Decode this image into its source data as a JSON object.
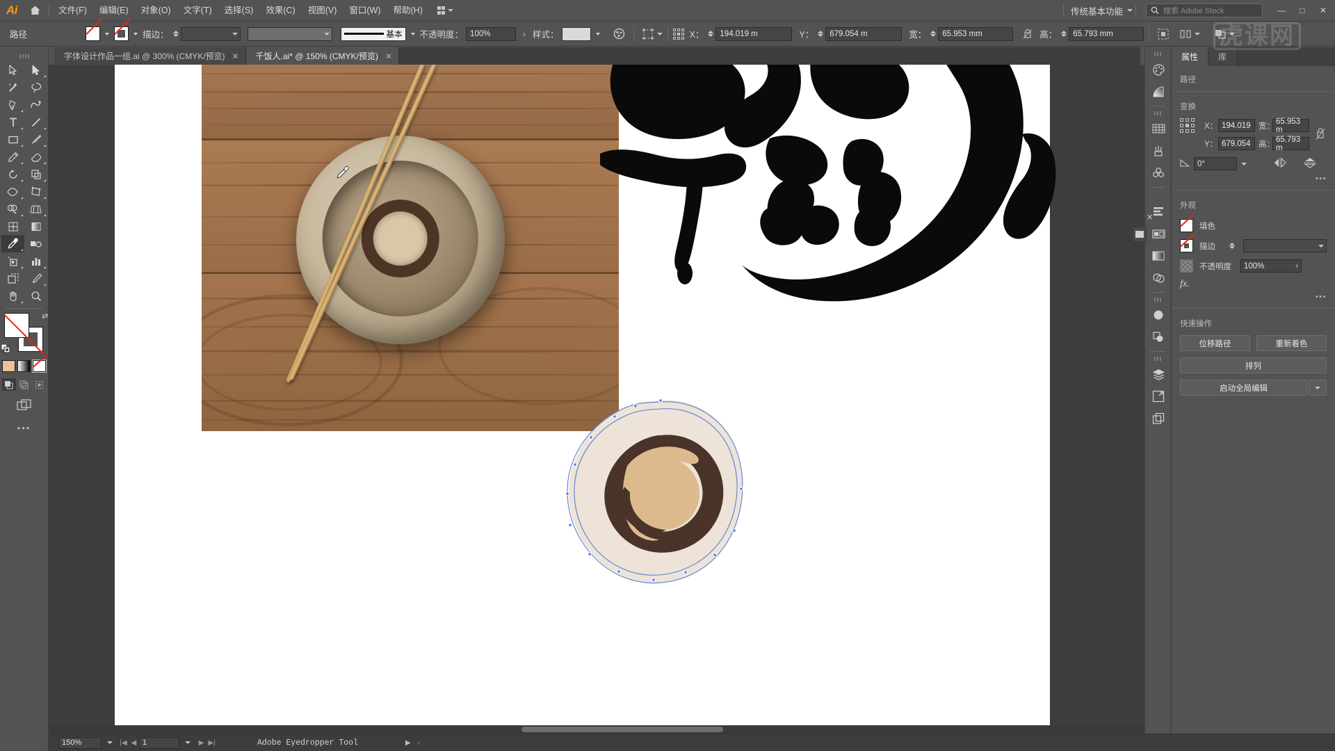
{
  "app": {
    "name": "Adobe Illustrator",
    "logo_text": "Ai",
    "watermark": "虎课网"
  },
  "menubar": {
    "items": [
      {
        "label": "文件(F)"
      },
      {
        "label": "编辑(E)"
      },
      {
        "label": "对象(O)"
      },
      {
        "label": "文字(T)"
      },
      {
        "label": "选择(S)"
      },
      {
        "label": "效果(C)"
      },
      {
        "label": "视图(V)"
      },
      {
        "label": "窗口(W)"
      },
      {
        "label": "帮助(H)"
      }
    ],
    "workspace": "传统基本功能",
    "stock_placeholder": "搜索 Adobe Stock",
    "window_buttons": {
      "minimize": "—",
      "maximize": "□",
      "close": "✕"
    }
  },
  "controlbar": {
    "object_label": "路径",
    "stroke_label": "描边：",
    "stroke_weight": "",
    "profile_name": "基本",
    "opacity_label": "不透明度：",
    "opacity_value": "100%",
    "style_label": "样式：",
    "x_label": "X：",
    "x_value": "194.019 m",
    "y_label": "Y：",
    "y_value": "679.054 m",
    "w_label": "宽：",
    "w_value": "65.953 mm",
    "h_label": "高：",
    "h_value": "65.793 mm"
  },
  "tabs": [
    {
      "label": "字体设计作品一组.ai @ 300% (CMYK/预览)",
      "active": false,
      "closable": true
    },
    {
      "label": "千饭人.ai* @ 150% (CMYK/预览)",
      "active": true,
      "closable": true
    }
  ],
  "toolbar": {
    "tools": [
      {
        "name": "selection-tool",
        "active": false
      },
      {
        "name": "direct-selection-tool",
        "active": false
      },
      {
        "name": "magic-wand-tool",
        "active": false
      },
      {
        "name": "lasso-tool",
        "active": false
      },
      {
        "name": "pen-tool",
        "active": false
      },
      {
        "name": "curvature-tool",
        "active": false
      },
      {
        "name": "type-tool",
        "active": false
      },
      {
        "name": "line-segment-tool",
        "active": false
      },
      {
        "name": "rectangle-tool",
        "active": false
      },
      {
        "name": "paintbrush-tool",
        "active": false
      },
      {
        "name": "shaper-pencil-tool",
        "active": false
      },
      {
        "name": "eraser-tool",
        "active": false
      },
      {
        "name": "rotate-tool",
        "active": false
      },
      {
        "name": "scale-tool",
        "active": false
      },
      {
        "name": "width-tool",
        "active": false
      },
      {
        "name": "free-transform-tool",
        "active": false
      },
      {
        "name": "shape-builder-tool",
        "active": false
      },
      {
        "name": "perspective-grid-tool",
        "active": false
      },
      {
        "name": "mesh-tool",
        "active": false
      },
      {
        "name": "gradient-tool",
        "active": false
      },
      {
        "name": "eyedropper-tool",
        "active": true
      },
      {
        "name": "blend-tool",
        "active": false
      },
      {
        "name": "symbol-sprayer-tool",
        "active": false
      },
      {
        "name": "column-graph-tool",
        "active": false
      },
      {
        "name": "artboard-tool",
        "active": false
      },
      {
        "name": "slice-tool",
        "active": false
      },
      {
        "name": "hand-tool",
        "active": false
      },
      {
        "name": "zoom-tool",
        "active": false
      }
    ],
    "fill_label": "填色",
    "stroke_label": "描边",
    "swatch_modes": [
      "color-swatch",
      "gradient-swatch",
      "none-swatch"
    ],
    "drawing_modes": [
      "draw-normal",
      "draw-behind",
      "draw-inside"
    ],
    "more_label": "•••"
  },
  "panel": {
    "tabs": [
      {
        "label": "属性",
        "active": true
      },
      {
        "label": "库",
        "active": false
      }
    ],
    "object_type": "路径",
    "transform": {
      "title": "变换",
      "x_label": "X：",
      "x_value": "194.019",
      "y_label": "Y：",
      "y_value": "679.054",
      "w_label": "宽：",
      "w_value": "65.953 m",
      "h_label": "高：",
      "h_value": "65.793 m",
      "angle_value": "0°",
      "more": "•••"
    },
    "appearance": {
      "title": "外观",
      "fill_label": "填色",
      "stroke_label": "描边",
      "stroke_weight": "",
      "opacity_label": "不透明度",
      "opacity_value": "100%",
      "fx_label": "fx.",
      "more": "•••"
    },
    "quick_actions": {
      "title": "快速操作",
      "offset_path": "位移路径",
      "recolor": "重新着色",
      "arrange": "排列",
      "global_edit": "启动全局编辑"
    }
  },
  "statusbar": {
    "zoom": "150%",
    "page": "1",
    "tool_status": "Adobe Eyedropper Tool"
  },
  "artwork": {
    "photo_caption": "木桌上的陶碗与筷子照片",
    "calligraphy_caption": "黑色书法笔触",
    "vector_bowl": {
      "blob_color": "#EDE3D8",
      "ring_color": "#4A3328",
      "center_color": "#DDBA8E",
      "anchor_color": "#3A6FD8"
    }
  },
  "colors": {
    "chrome": "#535353",
    "canvas_bg": "#3D3D3D",
    "artboard": "#FFFFFF",
    "accent_orange": "#FF9A00",
    "none_red": "#E0241A"
  }
}
